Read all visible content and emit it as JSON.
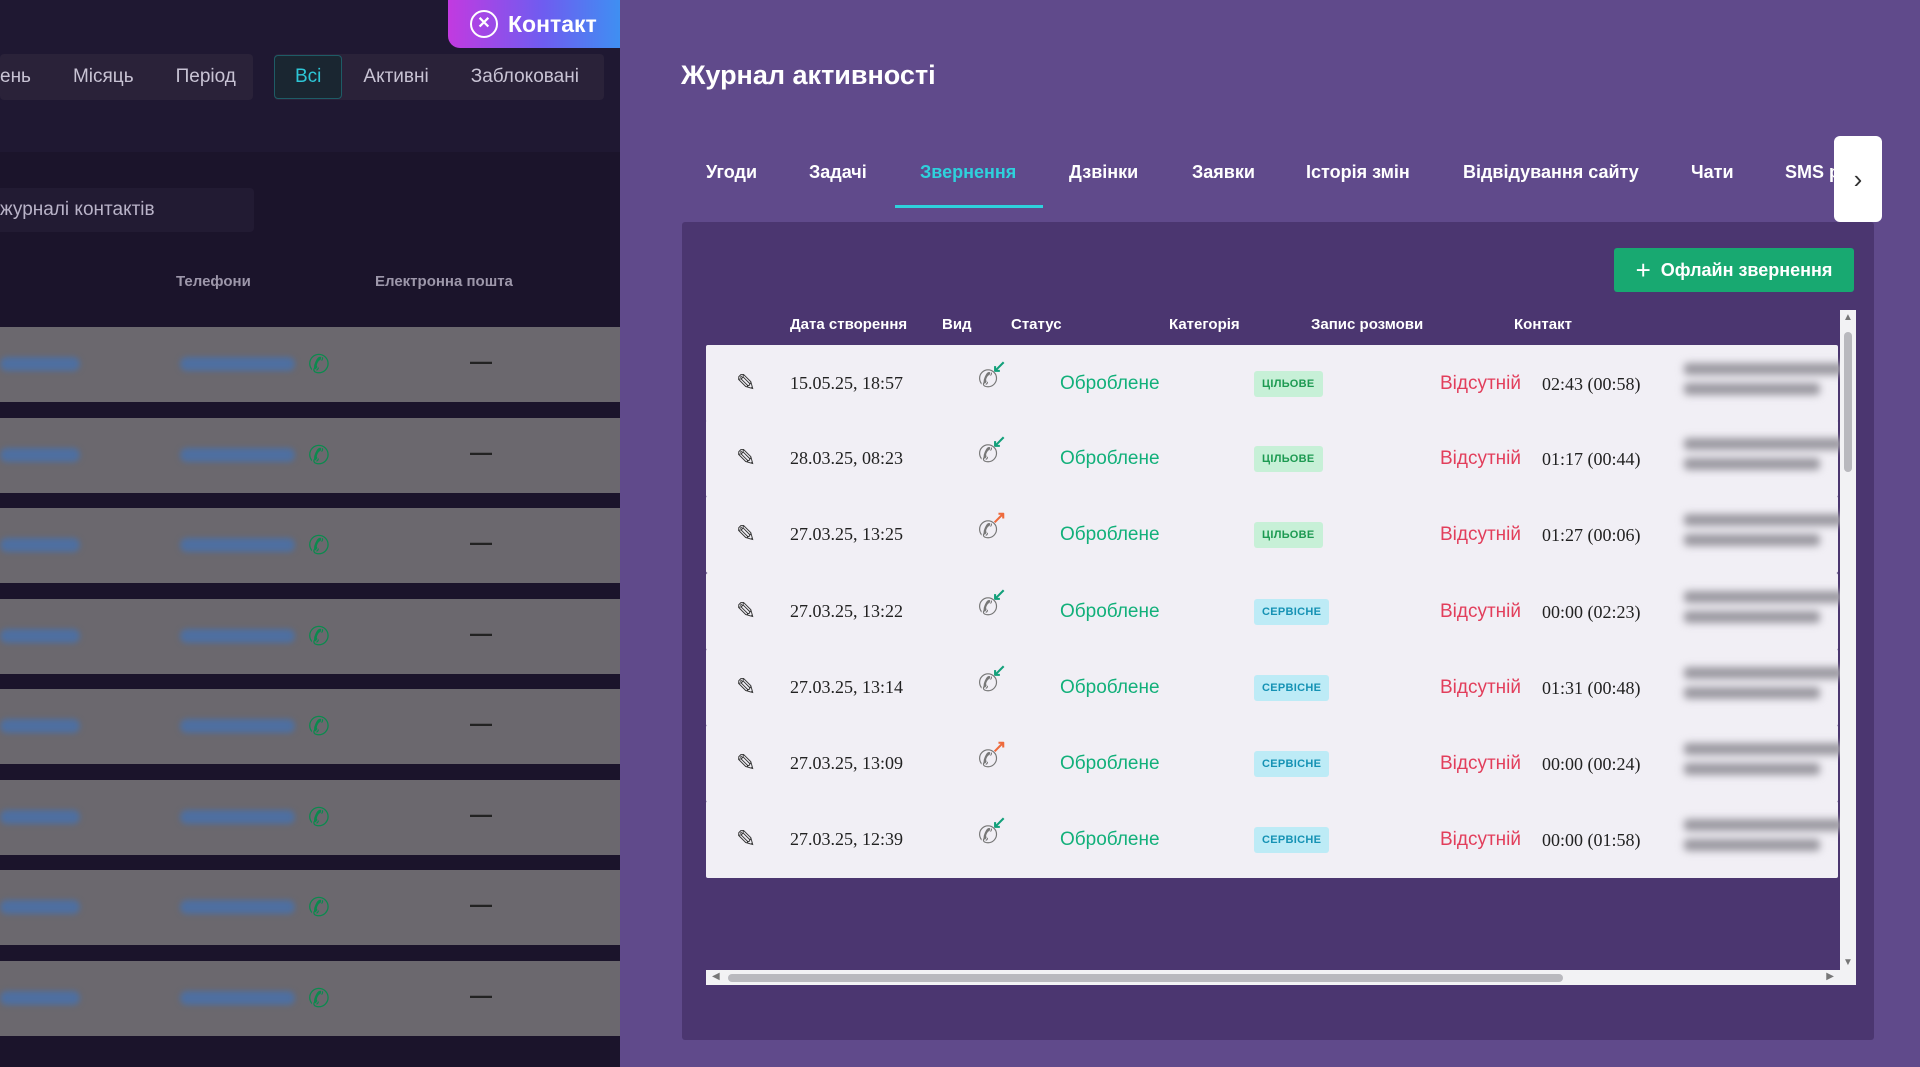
{
  "contact_button": {
    "label": "Контакт",
    "icon": "close-circle-icon"
  },
  "left": {
    "period_filters": [
      "ень",
      "Місяць",
      "Період"
    ],
    "status_filters": [
      "Всі",
      "Активні",
      "Заблоковані"
    ],
    "active_status_filter": "Всі",
    "search_placeholder": "журналі контактів",
    "columns": {
      "phones": "Телефони",
      "email": "Електронна пошта"
    },
    "rows": [
      {
        "email": "—"
      },
      {
        "email": "—"
      },
      {
        "email": "—"
      },
      {
        "email": "—"
      },
      {
        "email": "—"
      },
      {
        "email": "—"
      },
      {
        "email": "—"
      },
      {
        "email": "—"
      }
    ]
  },
  "panel": {
    "title": "Журнал активності",
    "tabs": [
      "Угоди",
      "Задачі",
      "Звернення",
      "Дзвінки",
      "Заявки",
      "Історія змін",
      "Відвідування сайту",
      "Чати",
      "SMS р"
    ],
    "active_tab": "Звернення",
    "offline_button": "Офлайн звернення",
    "table": {
      "headers": {
        "created": "Дата створення",
        "kind": "Вид",
        "status": "Статус",
        "category": "Категорія",
        "recording": "Запис розмови",
        "contact": "Контакт"
      },
      "rows": [
        {
          "date": "15.05.25, 18:57",
          "direction": "incoming",
          "status": "Оброблене",
          "category": "ЦІЛЬОВЕ",
          "category_type": "target",
          "recording": "Відсутній",
          "duration": "02:43  (00:58)"
        },
        {
          "date": "28.03.25, 08:23",
          "direction": "incoming",
          "status": "Оброблене",
          "category": "ЦІЛЬОВЕ",
          "category_type": "target",
          "recording": "Відсутній",
          "duration": "01:17  (00:44)"
        },
        {
          "date": "27.03.25, 13:25",
          "direction": "outgoing",
          "status": "Оброблене",
          "category": "ЦІЛЬОВЕ",
          "category_type": "target",
          "recording": "Відсутній",
          "duration": "01:27  (00:06)"
        },
        {
          "date": "27.03.25, 13:22",
          "direction": "incoming",
          "status": "Оброблене",
          "category": "СЕРВІСНЕ",
          "category_type": "service",
          "recording": "Відсутній",
          "duration": "00:00  (02:23)"
        },
        {
          "date": "27.03.25, 13:14",
          "direction": "incoming",
          "status": "Оброблене",
          "category": "СЕРВІСНЕ",
          "category_type": "service",
          "recording": "Відсутній",
          "duration": "01:31  (00:48)"
        },
        {
          "date": "27.03.25, 13:09",
          "direction": "outgoing",
          "status": "Оброблене",
          "category": "СЕРВІСНЕ",
          "category_type": "service",
          "recording": "Відсутній",
          "duration": "00:00  (00:24)"
        },
        {
          "date": "27.03.25, 12:39",
          "direction": "incoming",
          "status": "Оброблене",
          "category": "СЕРВІСНЕ",
          "category_type": "service",
          "recording": "Відсутній",
          "duration": "00:00  (01:58)"
        }
      ]
    }
  },
  "colors": {
    "panel_bg": "#604a8b",
    "accent_cyan": "#2ed1dc",
    "status_green": "#12b07a",
    "missing_red": "#e23e5b",
    "incoming_arrow": "#12a07a",
    "outgoing_arrow": "#ee6a3c"
  }
}
